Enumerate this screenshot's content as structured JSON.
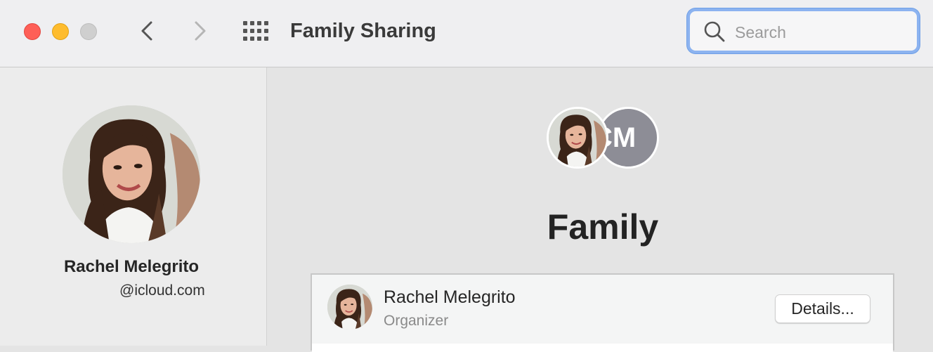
{
  "window": {
    "title": "Family Sharing"
  },
  "search": {
    "placeholder": "Search",
    "value": ""
  },
  "sidebar": {
    "user_name": "Rachel Melegrito",
    "email": "@icloud.com"
  },
  "main": {
    "avatars": [
      {
        "type": "photo",
        "name": "Rachel Melegrito"
      },
      {
        "type": "initials",
        "initials": "CM"
      }
    ],
    "heading": "Family",
    "members": [
      {
        "name": "Rachel Melegrito",
        "role": "Organizer",
        "action_label": "Details..."
      }
    ]
  },
  "colors": {
    "close": "#fe5f57",
    "minimize": "#febc2e",
    "zoom_inactive": "#cfcfcf",
    "search_focus": "#8cb3f0",
    "initials_avatar": "#8d8d96"
  },
  "icons": [
    "back-chevron-icon",
    "forward-chevron-icon",
    "grid-icon",
    "search-icon"
  ]
}
